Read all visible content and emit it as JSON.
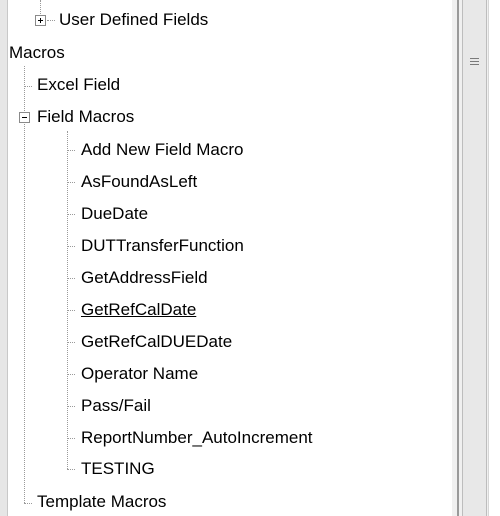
{
  "tree": {
    "top_item": "User Defined Fields",
    "section_label": "Macros",
    "excel_field": "Excel Field",
    "field_macros": {
      "label": "Field Macros",
      "children": [
        "Add New Field Macro",
        "AsFoundAsLeft",
        "DueDate",
        "DUTTransferFunction",
        "GetAddressField",
        "GetRefCalDate",
        "GetRefCalDUEDate",
        "Operator Name",
        "Pass/Fail",
        "ReportNumber_AutoIncrement",
        "TESTING"
      ]
    },
    "template_macros": "Template Macros"
  },
  "hovered_item": "GetRefCalDate"
}
